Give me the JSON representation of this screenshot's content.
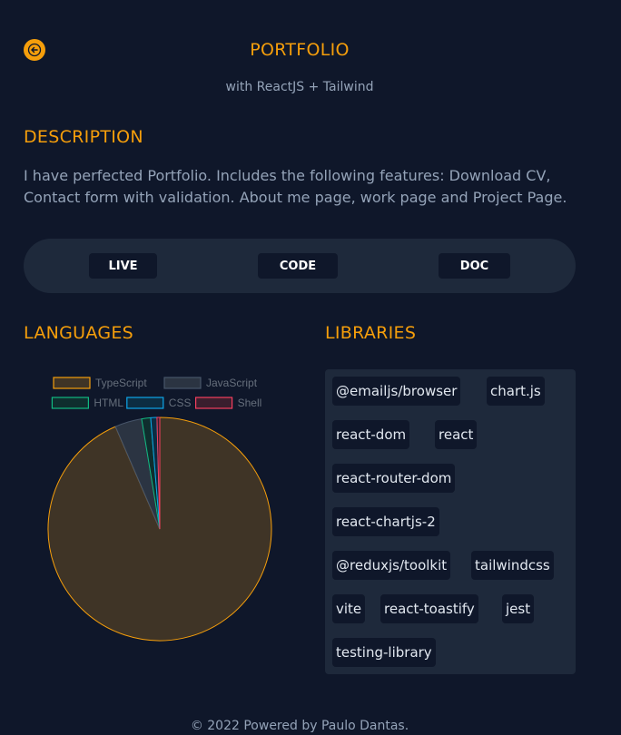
{
  "header": {
    "back_icon": "arrow-left-icon",
    "title": "PORTFOLIO",
    "subtitle": "with ReactJS + Tailwind"
  },
  "description": {
    "heading": "DESCRIPTION",
    "text": "I have perfected Portfolio. Includes the following features: Download CV, Contact form with validation. About me page, work page and Project Page."
  },
  "actions": [
    {
      "label": "LIVE"
    },
    {
      "label": "CODE"
    },
    {
      "label": "DOC"
    }
  ],
  "languages": {
    "heading": "LANGUAGES"
  },
  "chart_data": {
    "type": "pie",
    "legend_position": "top",
    "labels": [
      "TypeScript",
      "JavaScript",
      "HTML",
      "CSS",
      "Shell"
    ],
    "values": [
      93.5,
      3.9,
      1.3,
      0.9,
      0.4
    ],
    "colors": [
      "#f59e0b",
      "#475569",
      "#10b981",
      "#0ea5e9",
      "#f43f5e"
    ],
    "fills": [
      "#3f3426",
      "#2b3442",
      "#0f2e2e",
      "#0c2d42",
      "#3a1e2e"
    ]
  },
  "libraries": {
    "heading": "LIBRARIES",
    "items": [
      "@emailjs/browser",
      "chart.js",
      "react-dom",
      "react",
      "react-router-dom",
      "react-chartjs-2",
      "@reduxjs/toolkit",
      "tailwindcss",
      "vite",
      "react-toastify",
      "jest",
      "testing-library"
    ]
  },
  "footer": {
    "text": "© 2022 Powered by Paulo Dantas."
  },
  "colors": {
    "background": "#0f172a",
    "panel": "#1e293b",
    "accent": "#f59e0b",
    "muted_text": "#94a3b8"
  }
}
